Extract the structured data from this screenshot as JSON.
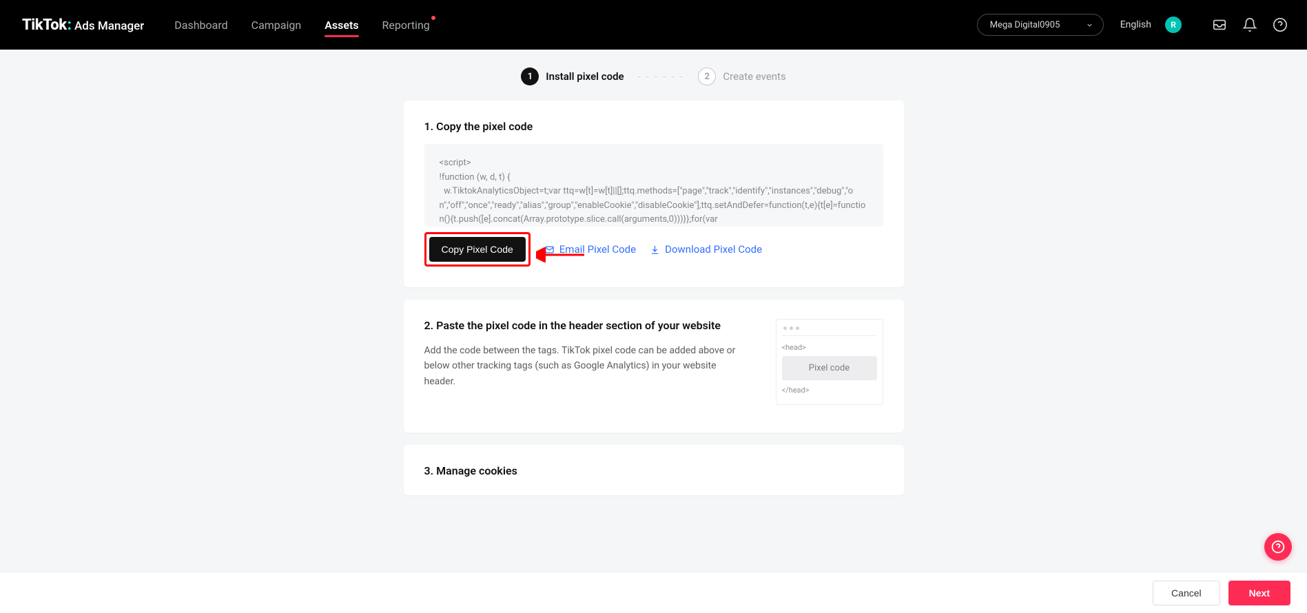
{
  "header": {
    "logo_main": "TikTok",
    "logo_sub": "Ads Manager",
    "nav": {
      "dashboard": "Dashboard",
      "campaign": "Campaign",
      "assets": "Assets",
      "reporting": "Reporting"
    },
    "account_name": "Mega Digital0905",
    "language": "English",
    "avatar_letter": "R"
  },
  "stepper": {
    "step1_num": "1",
    "step1_label": "Install pixel code",
    "step2_num": "2",
    "step2_label": "Create events"
  },
  "section1": {
    "title": "1. Copy the pixel code",
    "code": "<script>\n!function (w, d, t) {\n  w.TiktokAnalyticsObject=t;var ttq=w[t]=w[t]||[];ttq.methods=[\"page\",\"track\",\"identify\",\"instances\",\"debug\",\"on\",\"off\",\"once\",\"ready\",\"alias\",\"group\",\"enableCookie\",\"disableCookie\"],ttq.setAndDefer=function(t,e){t[e]=function(){t.push([e].concat(Array.prototype.slice.call(arguments,0)))}};for(var",
    "copy_label": "Copy Pixel Code",
    "email_label": "Email Pixel Code",
    "download_label": "Download Pixel Code"
  },
  "section2": {
    "title": "2. Paste the pixel code in the header section of your website",
    "desc": "Add the code between the tags. TikTok pixel code can be added above or below other tracking tags (such as Google Analytics) in your website header.",
    "mock_head_open": "<head>",
    "mock_pixel": "Pixel code",
    "mock_head_close": "</head>"
  },
  "section3": {
    "title": "3. Manage cookies"
  },
  "footer": {
    "cancel": "Cancel",
    "next": "Next"
  }
}
